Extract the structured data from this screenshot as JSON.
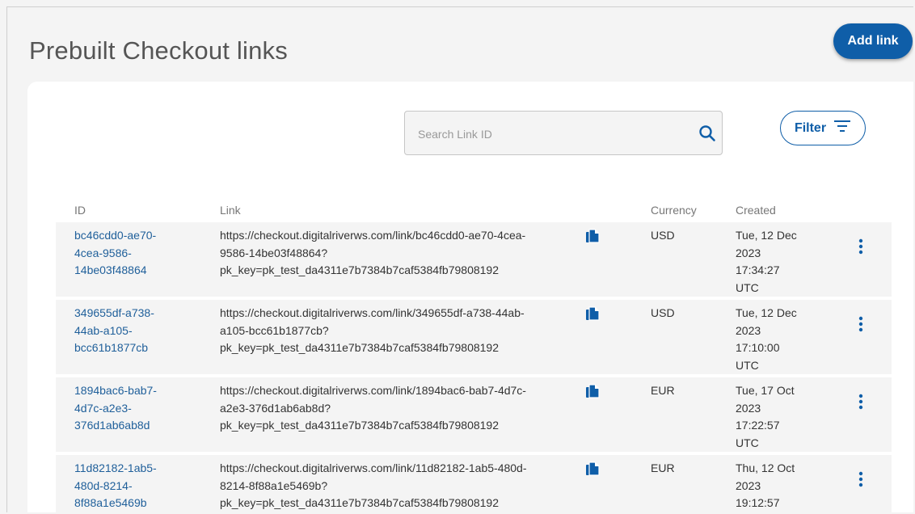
{
  "page": {
    "title": "Prebuilt Checkout links",
    "add_button": "Add link"
  },
  "toolbar": {
    "search_placeholder": "Search Link ID",
    "filter_label": "Filter"
  },
  "table": {
    "headers": {
      "id": "ID",
      "link": "Link",
      "currency": "Currency",
      "created": "Created"
    },
    "rows": [
      {
        "id": "bc46cdd0-ae70-\n4cea-9586-\n14be03f48864",
        "link": "https://checkout.digitalriverws.com/link/bc46cdd0-ae70-4cea-\n9586-14be03f48864?\npk_key=pk_test_da4311e7b7384b7caf5384fb79808192",
        "currency": "USD",
        "created": "Tue, 12 Dec\n2023\n17:34:27\nUTC"
      },
      {
        "id": "349655df-a738-\n44ab-a105-\nbcc61b1877cb",
        "link": "https://checkout.digitalriverws.com/link/349655df-a738-44ab-\na105-bcc61b1877cb?\npk_key=pk_test_da4311e7b7384b7caf5384fb79808192",
        "currency": "USD",
        "created": "Tue, 12 Dec\n2023\n17:10:00\nUTC"
      },
      {
        "id": "1894bac6-bab7-\n4d7c-a2e3-\n376d1ab6ab8d",
        "link": "https://checkout.digitalriverws.com/link/1894bac6-bab7-4d7c-\na2e3-376d1ab6ab8d?\npk_key=pk_test_da4311e7b7384b7caf5384fb79808192",
        "currency": "EUR",
        "created": "Tue, 17 Oct\n2023\n17:22:57\nUTC"
      },
      {
        "id": "11d82182-1ab5-\n480d-8214-\n8f88a1e5469b",
        "link": "https://checkout.digitalriverws.com/link/11d82182-1ab5-480d-\n8214-8f88a1e5469b?\npk_key=pk_test_da4311e7b7384b7caf5384fb79808192",
        "currency": "EUR",
        "created": "Thu, 12 Oct\n2023\n19:12:57"
      }
    ]
  },
  "icons": {
    "search": "search-icon",
    "filter": "filter-lines-icon",
    "copy": "copy-icon",
    "menu": "more-vertical-icon"
  },
  "colors": {
    "accent": "#0f5ea8",
    "link_text": "#1f5f9a",
    "row_bg": "#f4f4f4"
  }
}
